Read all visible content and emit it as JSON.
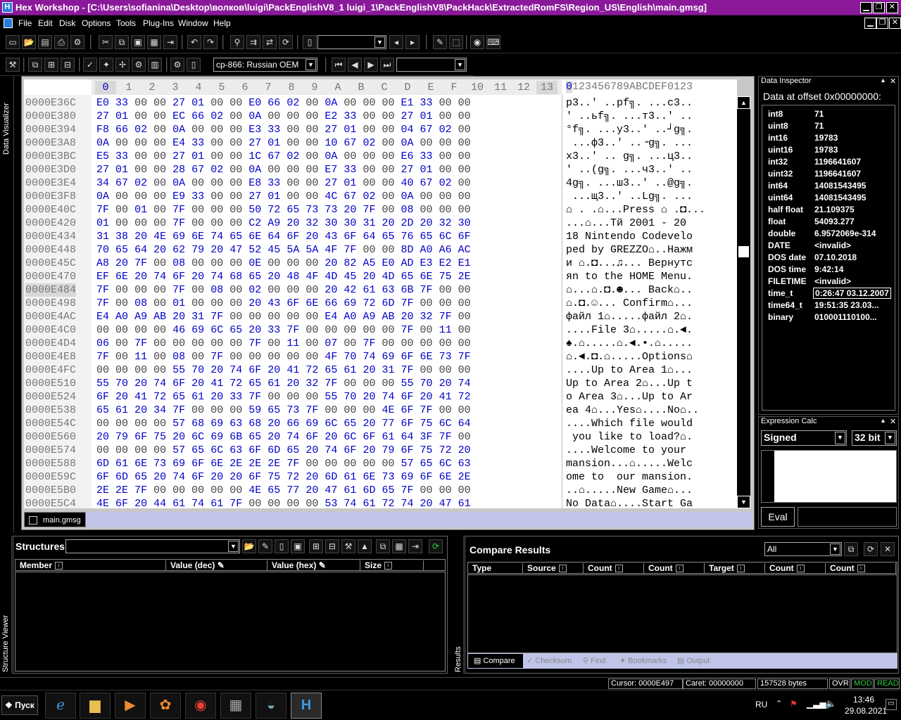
{
  "window": {
    "title": "Hex Workshop - [C:\\Users\\sofianina\\Desktop\\волков\\luigi\\PackEnglishV8_1 luigi_1\\PackEnglishV8\\PackHack\\ExtractedRomFS\\Region_US\\English\\main.gmsg]",
    "icon": "hex-workshop-icon",
    "minimize": "0",
    "restore": "2",
    "close": "X"
  },
  "menu": [
    "File",
    "Edit",
    "Disk",
    "Options",
    "Tools",
    "Plug-Ins",
    "Window",
    "Help"
  ],
  "toolbar": {
    "codepage": "cp-866: Russian OEM"
  },
  "side_panels": {
    "data_visualizer": "Data Visualizer",
    "structure_viewer": "Structure Viewer",
    "results": "Results"
  },
  "hex": {
    "columns": [
      "0",
      "1",
      "2",
      "3",
      "4",
      "5",
      "6",
      "7",
      "8",
      "9",
      "A",
      "B",
      "C",
      "D",
      "E",
      "F",
      "10",
      "11",
      "12",
      "13"
    ],
    "ascii_header": "0123456789ABCDEF0123",
    "rows": [
      {
        "o": "0000E36C",
        "h": "E0 33 00 00 27 01 00 00 E0 66 02 00 0A 00 00 00 E1 33 00 00",
        "a": "р3..' ..pf╗. ...с3.."
      },
      {
        "o": "0000E380",
        "h": "27 01 00 00 EC 66 02 00 0A 00 00 00 E2 33 00 00 27 01 00 00",
        "a": "' ..ьf╗. ...т3..' .."
      },
      {
        "o": "0000E394",
        "h": "F8 66 02 00 0A 00 00 00 E3 33 00 00 27 01 00 00 04 67 02 00",
        "a": "°f╗. ...у3..' ..┘g╗."
      },
      {
        "o": "0000E3A8",
        "h": "0A 00 00 00 E4 33 00 00 27 01 00 00 10 67 02 00 0A 00 00 00",
        "a": " ...ф3..' ..╶g╗. ..."
      },
      {
        "o": "0000E3BC",
        "h": "E5 33 00 00 27 01 00 00 1C 67 02 00 0A 00 00 00 E6 33 00 00",
        "a": "х3..' .. g╗. ...ц3.."
      },
      {
        "o": "0000E3D0",
        "h": "27 01 00 00 28 67 02 00 0A 00 00 00 E7 33 00 00 27 01 00 00",
        "a": "' ..(g╗. ...ч3..' .."
      },
      {
        "o": "0000E3E4",
        "h": "34 67 02 00 0A 00 00 00 E8 33 00 00 27 01 00 00 40 67 02 00",
        "a": "4g╗. ...ш3..' ..@g╗."
      },
      {
        "o": "0000E3F8",
        "h": "0A 00 00 00 E9 33 00 00 27 01 00 00 4C 67 02 00 0A 00 00 00",
        "a": " ...щ3..' ..Lg╗. ..."
      },
      {
        "o": "0000E40C",
        "h": "7F 00 01 00 7F 00 00 00 50 72 65 73 73 20 7F 00 08 00 00 00",
        "a": "⌂ . .⌂...Press ⌂ .◘..."
      },
      {
        "o": "0000E420",
        "h": "01 00 00 00 7F 00 00 00 C2 A9 20 32 30 30 31 20 2D 20 32 30",
        "a": "...⌂...Тй 2001 - 20"
      },
      {
        "o": "0000E434",
        "h": "31 38 20 4E 69 6E 74 65 6E 64 6F 20 43 6F 64 65 76 65 6C 6F",
        "a": "18 Nintendo Codevelo"
      },
      {
        "o": "0000E448",
        "h": "70 65 64 20 62 79 20 47 52 45 5A 5A 4F 7F 00 00 8D A0 A6 AC",
        "a": "ped by GREZZO⌂..Нажм"
      },
      {
        "o": "0000E45C",
        "h": "A8 20 7F 00 08 00 00 00 0E 00 00 00 20 82 A5 E0 AD E3 E2 E1",
        "a": "и ⌂.◘...♫... Вернутс"
      },
      {
        "o": "0000E470",
        "h": "EF 6E 20 74 6F 20 74 68 65 20 48 4F 4D 45 20 4D 65 6E 75 2E",
        "a": "яn to the HOME Menu."
      },
      {
        "o": "0000E484",
        "h": "7F 00 00 00 7F 00 08 00 02 00 00 00 20 42 61 63 6B 7F 00 00",
        "a": "⌂...⌂.◘.☻... Back⌂.."
      },
      {
        "o": "0000E498",
        "h": "7F 00 08 00 01 00 00 00 20 43 6F 6E 66 69 72 6D 7F 00 00 00",
        "a": "⌂.◘.☺... Confirm⌂..."
      },
      {
        "o": "0000E4AC",
        "h": "E4 A0 A9 AB 20 31 7F 00 00 00 00 00 E4 A0 A9 AB 20 32 7F 00",
        "a": "файл 1⌂.....файл 2⌂."
      },
      {
        "o": "0000E4C0",
        "h": "00 00 00 00 46 69 6C 65 20 33 7F 00 00 00 00 00 7F 00 11 00",
        "a": "....File 3⌂.....⌂.◄."
      },
      {
        "o": "0000E4D4",
        "h": "06 00 7F 00 00 00 00 00 7F 00 11 00 07 00 7F 00 00 00 00 00",
        "a": "♠.⌂.....⌂.◄.•.⌂....."
      },
      {
        "o": "0000E4E8",
        "h": "7F 00 11 00 08 00 7F 00 00 00 00 00 4F 70 74 69 6F 6E 73 7F",
        "a": "⌂.◄.◘.⌂.....Options⌂"
      },
      {
        "o": "0000E4FC",
        "h": "00 00 00 00 55 70 20 74 6F 20 41 72 65 61 20 31 7F 00 00 00",
        "a": "....Up to Area 1⌂..."
      },
      {
        "o": "0000E510",
        "h": "55 70 20 74 6F 20 41 72 65 61 20 32 7F 00 00 00 55 70 20 74",
        "a": "Up to Area 2⌂...Up t"
      },
      {
        "o": "0000E524",
        "h": "6F 20 41 72 65 61 20 33 7F 00 00 00 55 70 20 74 6F 20 41 72",
        "a": "o Area 3⌂...Up to Ar"
      },
      {
        "o": "0000E538",
        "h": "65 61 20 34 7F 00 00 00 59 65 73 7F 00 00 00 4E 6F 7F 00 00",
        "a": "ea 4⌂...Yes⌂....No⌂.."
      },
      {
        "o": "0000E54C",
        "h": "00 00 00 00 57 68 69 63 68 20 66 69 6C 65 20 77 6F 75 6C 64",
        "a": "....Which file would"
      },
      {
        "o": "0000E560",
        "h": "20 79 6F 75 20 6C 69 6B 65 20 74 6F 20 6C 6F 61 64 3F 7F 00",
        "a": " you like to load?⌂."
      },
      {
        "o": "0000E574",
        "h": "00 00 00 00 57 65 6C 63 6F 6D 65 20 74 6F 20 79 6F 75 72 20",
        "a": "....Welcome to your "
      },
      {
        "o": "0000E588",
        "h": "6D 61 6E 73 69 6F 6E 2E 2E 2E 7F 00 00 00 00 00 57 65 6C 63",
        "a": "mansion...⌂.....Welc"
      },
      {
        "o": "0000E59C",
        "h": "6F 6D 65 20 74 6F 20 20 6F 75 72 20 6D 61 6E 73 69 6F 6E 2E",
        "a": "ome to  our mansion."
      },
      {
        "o": "0000E5B0",
        "h": "2E 2E 7F 00 00 00 00 00 4E 65 77 20 47 61 6D 65 7F 00 00 00",
        "a": "..⌂.....New Game⌂..."
      },
      {
        "o": "0000E5C4",
        "h": "4E 6F 20 44 61 74 61 7F 00 00 00 00 53 74 61 72 74 20 47 61",
        "a": "No Data⌂....Start Ga"
      }
    ]
  },
  "file_tab": "main.gmsg",
  "data_inspector": {
    "header": "Data Inspector",
    "title": "Data at offset 0x00000000:",
    "rows": [
      {
        "label": "int8",
        "value": "71"
      },
      {
        "label": "uint8",
        "value": "71"
      },
      {
        "label": "int16",
        "value": "19783"
      },
      {
        "label": "uint16",
        "value": "19783"
      },
      {
        "label": "int32",
        "value": "1196641607"
      },
      {
        "label": "uint32",
        "value": "1196641607"
      },
      {
        "label": "int64",
        "value": "14081543495"
      },
      {
        "label": "uint64",
        "value": "14081543495"
      },
      {
        "label": "half float",
        "value": "21.109375"
      },
      {
        "label": "float",
        "value": "54093.277"
      },
      {
        "label": "double",
        "value": "6.9572069e-314"
      },
      {
        "label": "DATE",
        "value": "<invalid>"
      },
      {
        "label": "DOS date",
        "value": "07.10.2018"
      },
      {
        "label": "DOS time",
        "value": "9:42:14"
      },
      {
        "label": "FILETIME",
        "value": "<invalid>"
      },
      {
        "label": "time_t",
        "value": "0:26:47 03.12.2007"
      },
      {
        "label": "time64_t",
        "value": "19:51:35 23.03..."
      },
      {
        "label": "binary",
        "value": "010001110100..."
      }
    ]
  },
  "expression_calc": {
    "header": "Expression Calc",
    "sign": "Signed",
    "bits": "32 bit",
    "eval": "Eval"
  },
  "structures": {
    "label": "Structures",
    "columns": [
      "Member",
      "Value (dec)",
      "Value (hex)",
      "Size"
    ]
  },
  "compare": {
    "title": "Compare Results",
    "filter": "All",
    "columns": [
      "Type",
      "Source",
      "Count",
      "Count",
      "Target",
      "Count",
      "Count"
    ],
    "tabs": [
      "Compare",
      "Checksum",
      "Find",
      "Bookmarks",
      "Output"
    ]
  },
  "status": {
    "cursor": "Cursor: 0000E497",
    "caret": "Caret: 00000000",
    "size": "157528 bytes",
    "ovr": "OVR",
    "mod": "MOD",
    "read": "READ"
  },
  "taskbar": {
    "start": "Пуск",
    "lang": "RU",
    "time": "13:46",
    "date": "29.08.2021"
  },
  "colors": {
    "title": "#8a1a9a",
    "hex_value": "#0000c8",
    "status_green": "#2ecc40"
  }
}
